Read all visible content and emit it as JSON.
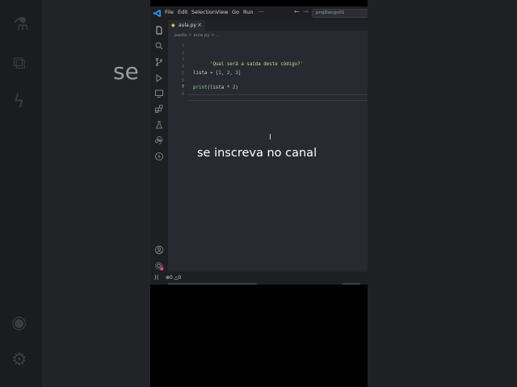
{
  "background": {
    "left_text": "se"
  },
  "titlebar": {
    "menu": [
      "File",
      "Edit",
      "Selection",
      "View",
      "Go",
      "Run",
      "···"
    ],
    "search_text": "projDango01"
  },
  "activity_bar": {
    "items": [
      "explorer-icon",
      "search-icon",
      "source-control-icon",
      "run-debug-icon",
      "remote-explorer-icon",
      "extensions-icon",
      "testing-icon",
      "python-icon",
      "lightning-icon"
    ],
    "bottom": [
      "account-icon",
      "settings-icon"
    ]
  },
  "editor": {
    "tab_label": "aula.py",
    "tab_close": "×",
    "breadcrumb": "pasta > aula.py > ...",
    "line_numbers": [
      "1",
      "2",
      "3",
      "4",
      "5",
      "6",
      "7",
      "8"
    ],
    "current_line": "7",
    "line3": "'Qual será a saída deste código?'",
    "line5_var": "lista",
    "line5_eq": " = [",
    "line5_n1": "1",
    "line5_c1": ", ",
    "line5_n2": "2",
    "line5_c2": ", ",
    "line5_n3": "3",
    "line5_end": "]",
    "line7_fn": "print",
    "line7_open": "(lista ",
    "line7_op": "*",
    "line7_num": " 2",
    "line7_close": ")"
  },
  "overlay_caption": "se inscreva no canal",
  "statusbar": {
    "errors": "0",
    "warnings": "0"
  },
  "colors": {
    "string": "#e3d28a",
    "number": "#9fd2a8",
    "function": "#8fd18c",
    "settings_badge": "#e0488a"
  }
}
